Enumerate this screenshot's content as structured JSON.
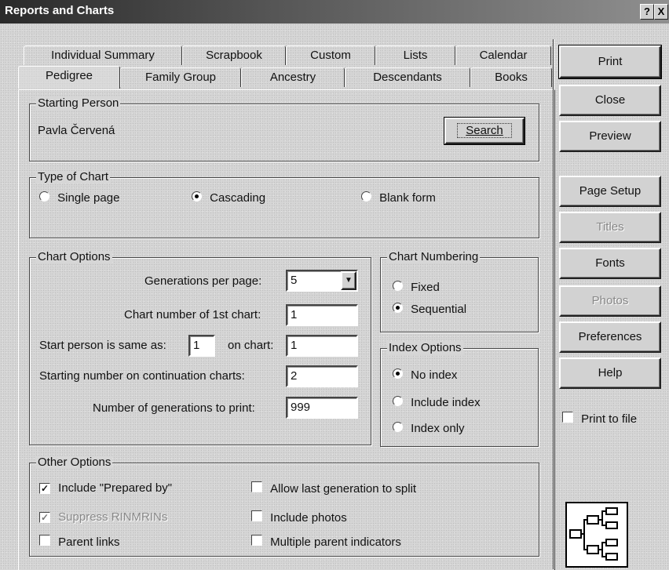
{
  "window": {
    "title": "Reports and Charts",
    "help_btn": "?",
    "close_btn": "X"
  },
  "tabs_back": [
    "Individual Summary",
    "Scrapbook",
    "Custom",
    "Lists",
    "Calendar"
  ],
  "tabs_front": [
    "Pedigree",
    "Family Group",
    "Ancestry",
    "Descendants",
    "Books"
  ],
  "starting_person": {
    "legend": "Starting Person",
    "name": "Pavla Červená",
    "search_label": "Search"
  },
  "chart_type": {
    "legend": "Type of Chart",
    "options": [
      {
        "label": "Single page",
        "selected": false
      },
      {
        "label": "Cascading",
        "selected": true
      },
      {
        "label": "Blank form",
        "selected": false
      }
    ]
  },
  "chart_options": {
    "legend": "Chart Options",
    "generations_label": "Generations per page:",
    "generations_value": "5",
    "chart_number_label": "Chart number of 1st chart:",
    "chart_number_value": "1",
    "start_person_label": "Start person is same as:",
    "start_person_value": "1",
    "on_chart_label": "on chart:",
    "on_chart_value": "1",
    "continuation_label": "Starting number on continuation charts:",
    "continuation_value": "2",
    "num_generations_label": "Number of generations to print:",
    "num_generations_value": "999"
  },
  "chart_numbering": {
    "legend": "Chart Numbering",
    "options": [
      {
        "label": "Fixed",
        "selected": false
      },
      {
        "label": "Sequential",
        "selected": true
      }
    ]
  },
  "index_options": {
    "legend": "Index Options",
    "options": [
      {
        "label": "No index",
        "selected": true
      },
      {
        "label": "Include index",
        "selected": false
      },
      {
        "label": "Index only",
        "selected": false
      }
    ]
  },
  "other_options": {
    "legend": "Other Options",
    "items": [
      {
        "label": "Include \"Prepared by\"",
        "checked": true,
        "disabled": false
      },
      {
        "label": "Suppress RINMRINs",
        "checked": true,
        "disabled": true
      },
      {
        "label": "Parent links",
        "checked": false,
        "disabled": false
      },
      {
        "label": "Allow last generation to split",
        "checked": false,
        "disabled": false
      },
      {
        "label": "Include photos",
        "checked": false,
        "disabled": false
      },
      {
        "label": "Multiple parent indicators",
        "checked": false,
        "disabled": false
      }
    ]
  },
  "side_buttons": {
    "print": "Print",
    "close": "Close",
    "preview": "Preview",
    "page_setup": "Page Setup",
    "titles": "Titles",
    "fonts": "Fonts",
    "photos": "Photos",
    "preferences": "Preferences",
    "help": "Help",
    "print_to_file": "Print to file"
  },
  "icons": {
    "pedigree_chart": "pedigree-chart-icon",
    "dropdown": "chevron-down-icon"
  }
}
